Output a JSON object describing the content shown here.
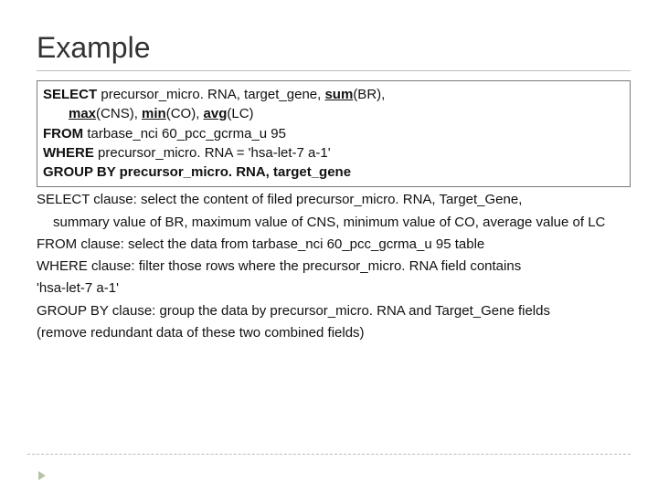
{
  "title": "Example",
  "sql": {
    "l1_kw": "SELECT",
    "l1_rest_a": " precursor_micro. RNA, target_gene, ",
    "l1_sum": "sum",
    "l1_sum_arg": "(BR),",
    "l2_max": "max",
    "l2_max_arg": "(CNS), ",
    "l2_min": "min",
    "l2_min_arg": "(CO), ",
    "l2_avg": "avg",
    "l2_avg_arg": "(LC)",
    "l3_kw": "FROM",
    "l3_rest": " tarbase_nci 60_pcc_gcrma_u 95",
    "l4_kw": "WHERE",
    "l4_rest": " precursor_micro. RNA = 'hsa-let-7 a-1'",
    "l5_pre": " ",
    "l5_kw": "GROUP BY",
    "l5_rest": " precursor_micro. RNA, target_gene"
  },
  "explain": {
    "select1": "SELECT clause: select the content of filed precursor_micro. RNA, Target_Gene,",
    "select2": "summary value of BR, maximum value of CNS, minimum value of CO, average value of LC",
    "from": "FROM clause:  select the data from tarbase_nci 60_pcc_gcrma_u 95 table",
    "where1": "WHERE clause:  filter those rows where the precursor_micro. RNA field contains",
    "where2": " 'hsa-let-7 a-1'",
    "group1": "GROUP BY clause: group the data by precursor_micro. RNA and Target_Gene fields",
    "group2": "(remove redundant data of these two combined fields)"
  }
}
